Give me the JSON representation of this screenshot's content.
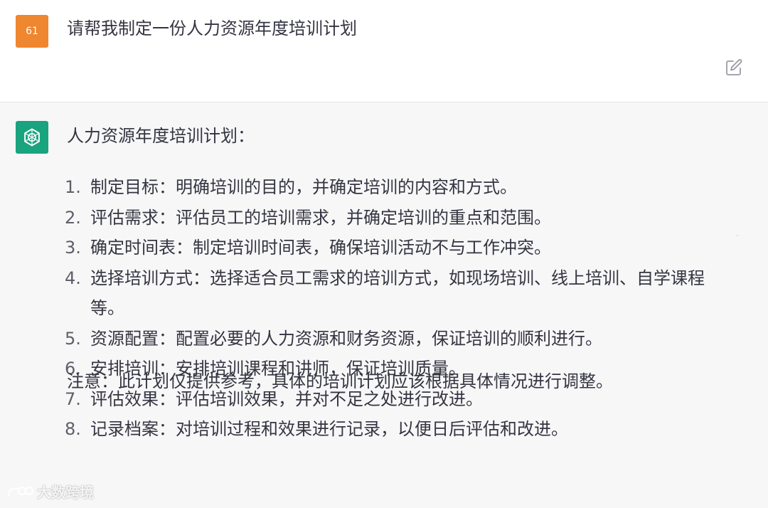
{
  "user_message": {
    "avatar_label": "61",
    "avatar_color": "#ef8630",
    "text": "请帮我制定一份人力资源年度培训计划",
    "edit_icon": "edit-icon"
  },
  "assistant_message": {
    "avatar_icon": "openai-logo-icon",
    "avatar_color": "#19a37f",
    "heading": "人力资源年度培训计划：",
    "items": [
      {
        "num": "1.",
        "text": "制定目标：明确培训的目的，并确定培训的内容和方式。"
      },
      {
        "num": "2.",
        "text": "评估需求：评估员工的培训需求，并确定培训的重点和范围。"
      },
      {
        "num": "3.",
        "text": "确定时间表：制定培训时间表，确保培训活动不与工作冲突。"
      },
      {
        "num": "4.",
        "text": "选择培训方式：选择适合员工需求的培训方式，如现场培训、线上培训、自学课程等。"
      },
      {
        "num": "5.",
        "text": "资源配置：配置必要的人力资源和财务资源，保证培训的顺利进行。"
      },
      {
        "num": "6.",
        "text": "安排培训：安排培训课程和讲师，保证培训质量。"
      },
      {
        "num": "7.",
        "text": "评估效果：评估培训效果，并对不足之处进行改进。"
      },
      {
        "num": "8.",
        "text": "记录档案：对培训过程和效果进行记录，以便日后评估和改进。"
      }
    ],
    "note": "注意：此计划仅提供参考，具体的培训计划应该根据具体情况进行调整。"
  },
  "watermark": {
    "text": "大数跨境",
    "icon": "brand-logo-icon"
  }
}
